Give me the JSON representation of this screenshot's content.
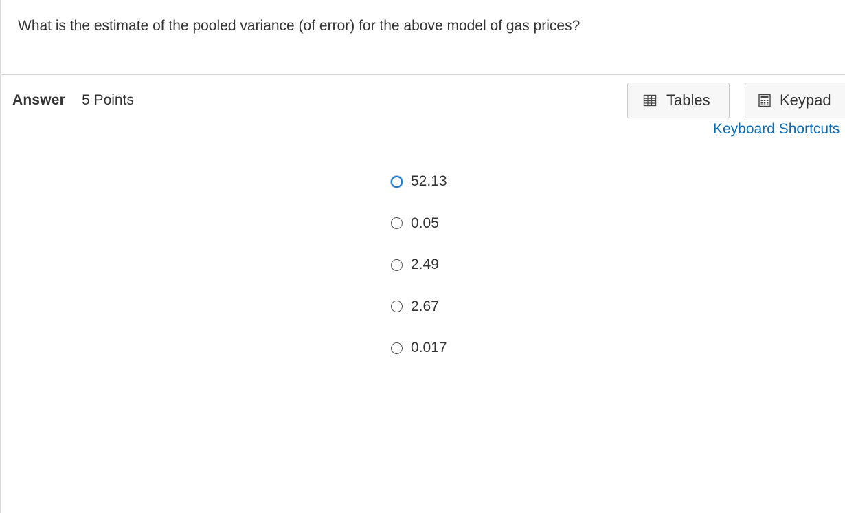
{
  "question": {
    "text": "What is the estimate of the pooled variance (of error) for the above model of gas prices?"
  },
  "answer": {
    "label": "Answer",
    "points": "5 Points"
  },
  "toolbar": {
    "tables_label": "Tables",
    "tables_icon": "table-icon",
    "keypad_label": "Keypad",
    "keypad_icon": "calculator-icon",
    "shortcuts_label": "Keyboard Shortcuts"
  },
  "options": [
    {
      "label": "52.13",
      "focused": true
    },
    {
      "label": "0.05",
      "focused": false
    },
    {
      "label": "2.49",
      "focused": false
    },
    {
      "label": "2.67",
      "focused": false
    },
    {
      "label": "0.017",
      "focused": false
    }
  ],
  "colors": {
    "link": "#0b6cb4",
    "focus_ring": "#1f78c8",
    "button_bg": "#f7f7f7",
    "text": "#333333"
  }
}
